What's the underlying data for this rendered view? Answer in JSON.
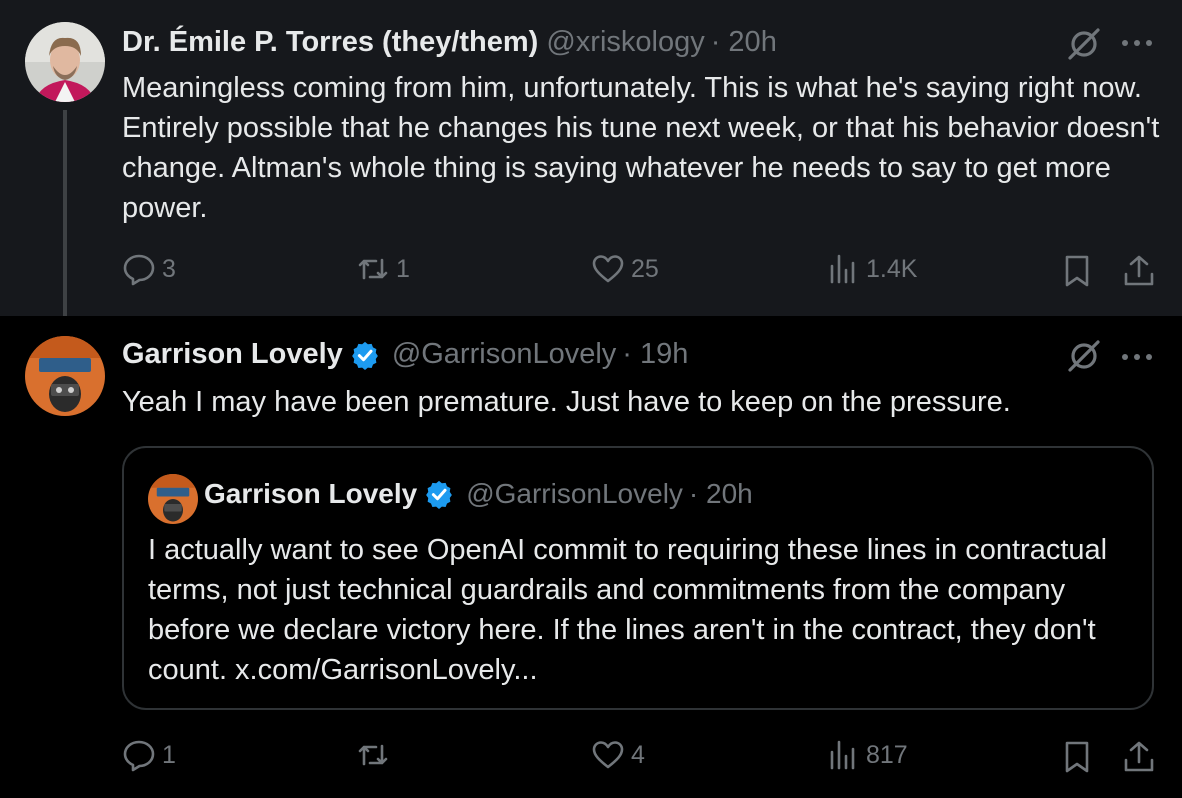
{
  "colors": {
    "background": "#000000",
    "highlight_background": "#16181c",
    "text": "#e7e9ea",
    "muted": "#71767b",
    "verified_blue": "#1d9bf0",
    "border": "#2f3336"
  },
  "tweets": [
    {
      "author_name": "Dr. Émile P. Torres (they/them)",
      "handle": "@xriskology",
      "time": "· 20h",
      "verified": false,
      "text": "Meaningless coming from him, unfortunately. This is what he's saying right now. Entirely possible that he changes his tune next week, or that his behavior doesn't change. Altman's whole thing is saying whatever he needs to say to get more power.",
      "stats": {
        "replies": "3",
        "reposts": "1",
        "likes": "25",
        "views": "1.4K"
      },
      "icons": [
        "grok-icon",
        "more-icon",
        "reply-icon",
        "repost-icon",
        "like-icon",
        "views-icon",
        "bookmark-icon",
        "share-icon"
      ]
    },
    {
      "author_name": "Garrison Lovely",
      "handle": "@GarrisonLovely",
      "time": "· 19h",
      "verified": true,
      "text": "Yeah I may have been premature. Just have to keep on the pressure.",
      "quote": {
        "author_name": "Garrison Lovely",
        "handle": "@GarrisonLovely",
        "time": "· 20h",
        "verified": true,
        "text": "I actually want to see OpenAI commit to requiring these lines in contractual terms, not just technical guardrails and commitments from the company before we declare victory here. If the lines aren't in the contract, they don't count. x.com/GarrisonLovely..."
      },
      "stats": {
        "replies": "1",
        "reposts": "",
        "likes": "4",
        "views": "817"
      }
    }
  ]
}
